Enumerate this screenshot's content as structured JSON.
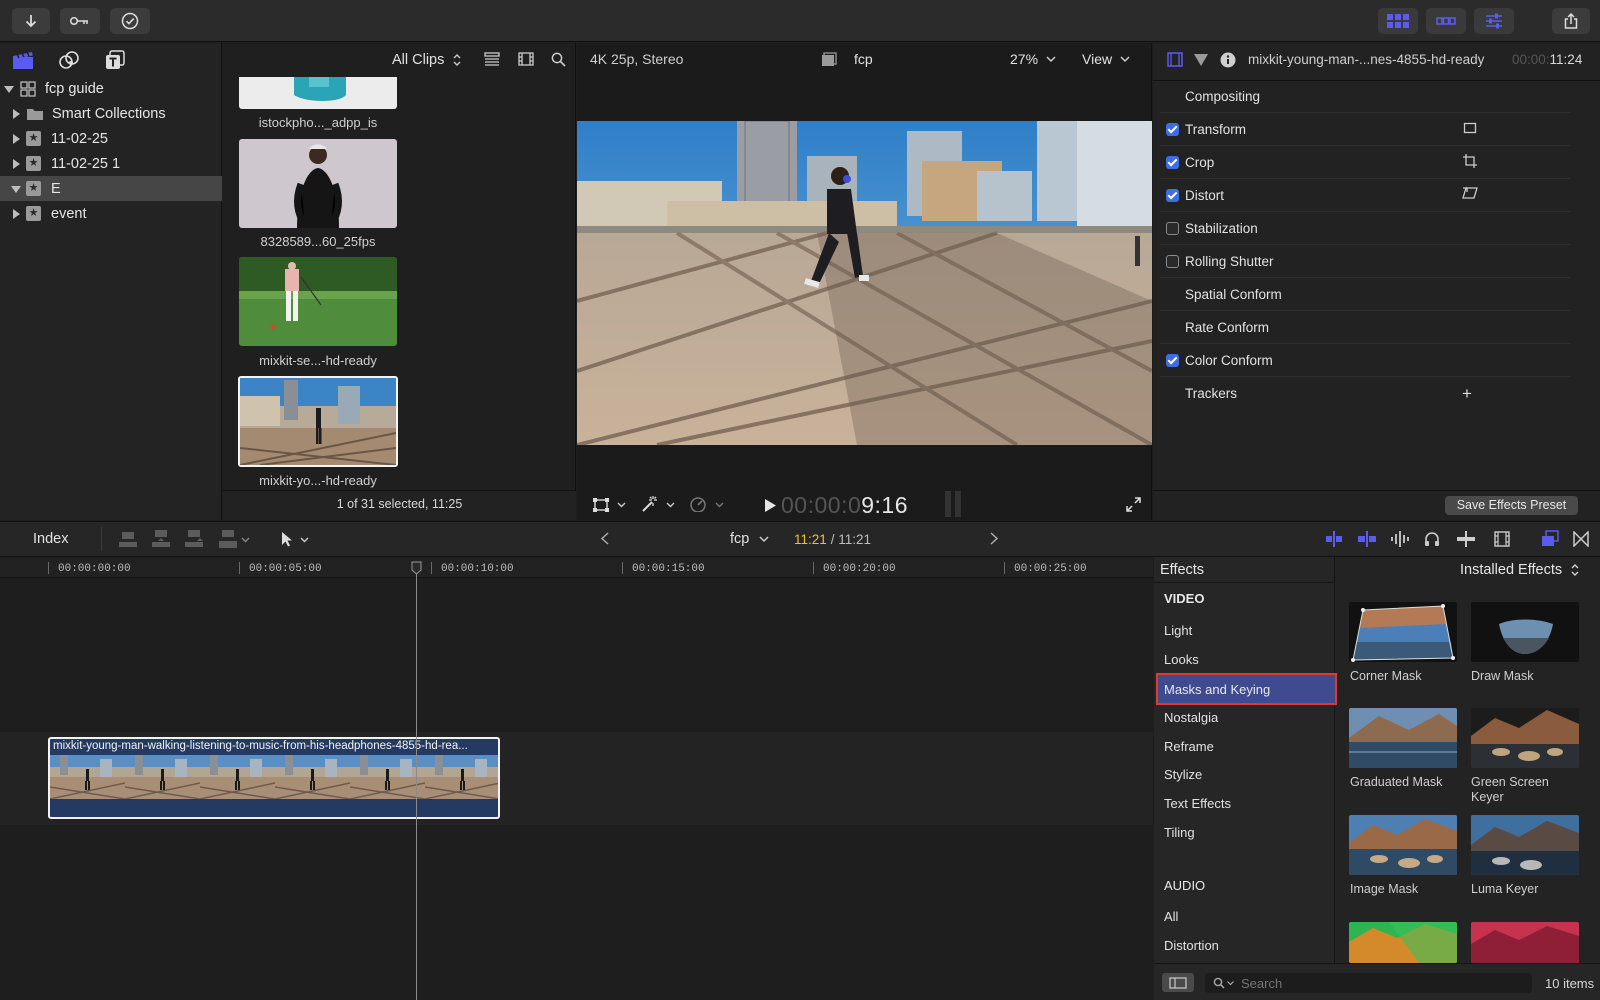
{
  "toolbar": {
    "import_icon": "down-arrow-icon",
    "keyword_icon": "key-icon",
    "background_tasks_icon": "checkmark-circle-icon",
    "share_icon": "share-icon"
  },
  "browser": {
    "filter_label": "All Clips",
    "status": "1 of 31 selected, 11:25",
    "library": [
      {
        "label": "fcp guide",
        "kind": "library"
      },
      {
        "label": "Smart Collections",
        "kind": "folder"
      },
      {
        "label": "11-02-25",
        "kind": "event"
      },
      {
        "label": "11-02-25 1",
        "kind": "event"
      },
      {
        "label": "E",
        "kind": "event",
        "selected": true
      },
      {
        "label": "event",
        "kind": "event"
      }
    ],
    "clips": [
      {
        "label": "istockpho..._adpp_is"
      },
      {
        "label": "8328589...60_25fps"
      },
      {
        "label": "mixkit-se...-hd-ready"
      },
      {
        "label": "mixkit-yo...-hd-ready",
        "selected": true
      }
    ]
  },
  "viewer": {
    "format": "4K 25p, Stereo",
    "project": "fcp",
    "zoom": "27%",
    "view_label": "View",
    "timecode_dim": "00:00:0",
    "timecode_bright": "9:16"
  },
  "inspector": {
    "clip_name": "mixkit-young-man-...nes-4855-hd-ready",
    "duration_dim": "00:00:",
    "duration_bright": "11:24",
    "rows": [
      {
        "label": "Compositing",
        "checkbox": null
      },
      {
        "label": "Transform",
        "checkbox": true
      },
      {
        "label": "Crop",
        "checkbox": true
      },
      {
        "label": "Distort",
        "checkbox": true
      },
      {
        "label": "Stabilization",
        "checkbox": false
      },
      {
        "label": "Rolling Shutter",
        "checkbox": false
      },
      {
        "label": "Spatial Conform",
        "checkbox": null
      },
      {
        "label": "Rate Conform",
        "checkbox": null
      },
      {
        "label": "Color Conform",
        "checkbox": true
      },
      {
        "label": "Trackers",
        "checkbox": null
      }
    ],
    "trackers_add": "+",
    "save_preset": "Save Effects Preset"
  },
  "timeline": {
    "index_label": "Index",
    "project": "fcp",
    "position": "11:21",
    "duration": "/ 11:21",
    "ruler": [
      "00:00:00:00",
      "00:00:05:00",
      "00:00:10:00",
      "00:00:15:00",
      "00:00:20:00",
      "00:00:25:00"
    ],
    "clip_name": "mixkit-young-man-walking-listening-to-music-from-his-headphones-4855-hd-rea..."
  },
  "effects": {
    "title": "Effects",
    "source": "Installed Effects",
    "video_header": "VIDEO",
    "categories": [
      "Light",
      "Looks",
      "Masks and Keying",
      "Nostalgia",
      "Reframe",
      "Stylize",
      "Text Effects",
      "Tiling"
    ],
    "selected_category": "Masks and Keying",
    "audio_header": "AUDIO",
    "audio_categories": [
      "All",
      "Distortion"
    ],
    "items": [
      "Corner Mask",
      "Draw Mask",
      "Graduated Mask",
      "Green Screen Keyer",
      "Image Mask",
      "Luma Keyer"
    ],
    "search_placeholder": "Search",
    "count": "10 items"
  },
  "colors": {
    "accent": "#5a5cf0",
    "selection_outline": "#e03a2f",
    "selected_row": "#3f4a8f",
    "timecode_yellow": "#e8c23a"
  }
}
